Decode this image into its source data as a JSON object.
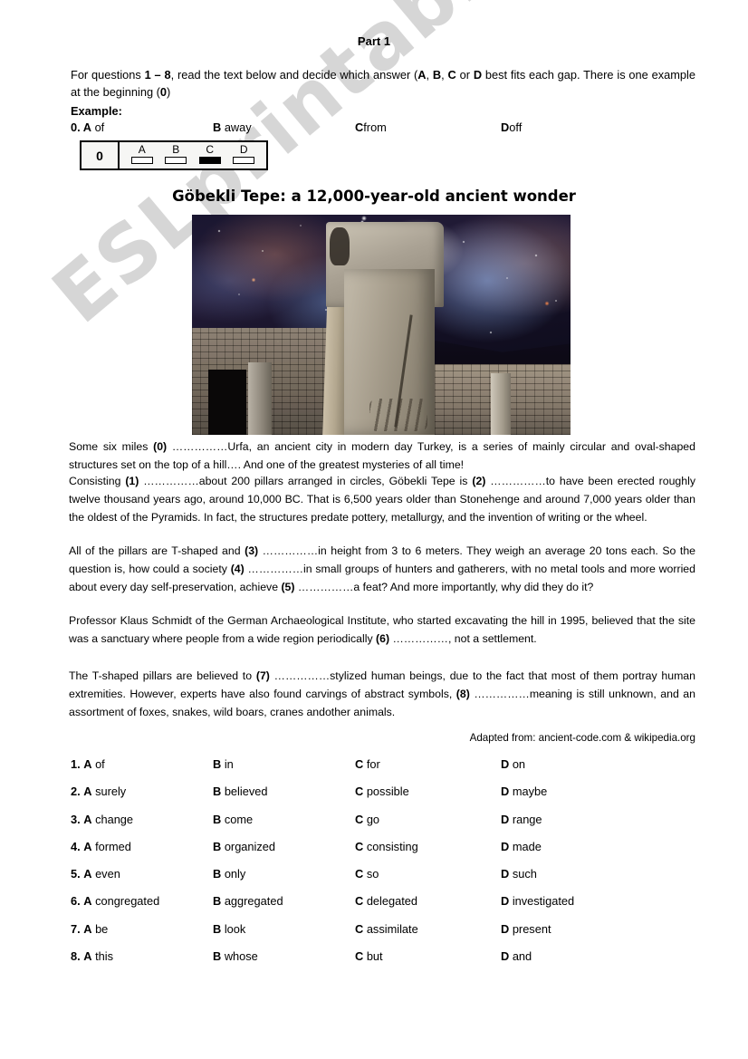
{
  "watermark": {
    "text": "ESLprintables.com"
  },
  "header": {
    "part_title": "Part 1",
    "instructions_html": "For questions <b>1 &ndash; 8</b>, read the text below and decide which answer (<b>A</b>, <b>B</b>, <b>C</b> or <b>D</b> best fits each gap. There is one example at the beginning (<b>0</b>)",
    "example_label": "Example:"
  },
  "example": {
    "options": [
      {
        "letter": "0. A",
        "text": "of"
      },
      {
        "letter": "B",
        "text": "away"
      },
      {
        "letter": "C",
        "text": "from"
      },
      {
        "letter": "D",
        "text": "off"
      }
    ],
    "answer_box": {
      "question_number": "0",
      "choices": [
        {
          "letter": "A",
          "filled": false
        },
        {
          "letter": "B",
          "filled": false
        },
        {
          "letter": "C",
          "filled": true
        },
        {
          "letter": "D",
          "filled": false
        }
      ]
    }
  },
  "article": {
    "title": "Göbekli Tepe: a 12,000-year-old ancient wonder",
    "image": {
      "alt_name": "gobekli-tepe-pillar-under-nebula-sky"
    },
    "paragraphs_html": [
      "Some six miles <b>(0)</b> ……………Urfa, an ancient city in modern day Turkey, is a series of mainly circular and oval-shaped structures set on the top of a hill…. And one of the greatest mysteries of all time!",
      "Consisting <b>(1)</b> ……………about 200 pillars arranged in circles, Göbekli Tepe is <b>(2)</b> ……………to have been erected roughly twelve thousand years ago, around 10,000 BC. That is 6,500 years older than Stonehenge and around 7,000 years older than the oldest of the Pyramids. In fact, the structures predate pottery, metallurgy, and the invention of writing or the wheel.",
      "All of the pillars are T-shaped and <b>(3)</b> ……………in height from 3 to 6 meters. They weigh an average 20 tons each. So the question is, how could a society <b>(4)</b> ……………in small groups of hunters and gatherers, with no metal tools and more worried about every day self-preservation, achieve <b>(5)</b> ……………a feat? And more importantly, why did they do it?",
      "Professor Klaus Schmidt of the German Archaeological Institute, who started excavating the hill in 1995, believed that the site was a sanctuary where people from a wide region periodically <b>(6)</b> ……………, not a settlement.",
      "The T-shaped pillars are believed to <b>(7)</b> ……………stylized human beings, due to the fact that most of them portray human extremities. However, experts have also found carvings of abstract symbols, <b>(8)</b> ……………meaning is still unknown, and an assortment of foxes, snakes, wild boars, cranes andother animals."
    ],
    "source": "Adapted from: ancient-code.com & wikipedia.org"
  },
  "questions": [
    {
      "number": "1.",
      "a": "of",
      "b": "in",
      "c": "for",
      "d": "on"
    },
    {
      "number": "2.",
      "a": "surely",
      "b": "believed",
      "c": "possible",
      "d": "maybe"
    },
    {
      "number": "3.",
      "a": "change",
      "b": "come",
      "c": "go",
      "d": "range"
    },
    {
      "number": "4.",
      "a": "formed",
      "b": "organized",
      "c": "consisting",
      "d": "made"
    },
    {
      "number": "5.",
      "a": "even",
      "b": "only",
      "c": "so",
      "d": "such"
    },
    {
      "number": "6.",
      "a": "congregated",
      "b": "aggregated",
      "c": "delegated",
      "d": "investigated"
    },
    {
      "number": "7.",
      "a": "be",
      "b": "look",
      "c": "assimilate",
      "d": "present"
    },
    {
      "number": "8.",
      "a": "this",
      "b": "whose",
      "c": "but",
      "d": "and"
    }
  ],
  "letters": {
    "a": "A",
    "b": "B",
    "c": "C",
    "d": "D"
  }
}
